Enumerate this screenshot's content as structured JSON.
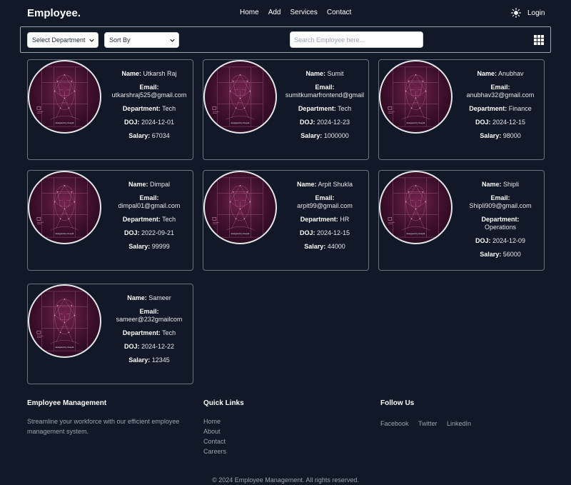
{
  "nav": {
    "brand": "Employee.",
    "links": [
      "Home",
      "Add",
      "Services",
      "Contact"
    ],
    "login": "Login"
  },
  "filters": {
    "department_selected": "Select Department",
    "sort_selected": "Sort By",
    "search_placeholder": "Search Employee here..."
  },
  "labels": {
    "name": "Name:",
    "email": "Email:",
    "department": "Department:",
    "doj": "DOJ:",
    "salary": "Salary:"
  },
  "employees": [
    {
      "name": "Utkarsh Raj",
      "email": "utkarshraj525@gmail.com",
      "department": "Tech",
      "doj": "2024-12-01",
      "salary": "67034"
    },
    {
      "name": "Sumit",
      "email": "sumitkumarfrontend@gmail",
      "department": "Tech",
      "doj": "2024-12-23",
      "salary": "1000000"
    },
    {
      "name": "Anubhav",
      "email": "anubhav32@gmail.com",
      "department": "Finance",
      "doj": "2024-12-15",
      "salary": "98000"
    },
    {
      "name": "Dimpal",
      "email": "dimpal01@gmail.com",
      "department": "Tech",
      "doj": "2022-09-21",
      "salary": "99999"
    },
    {
      "name": "Arpit Shukla",
      "email": "arpit99@gmail.com",
      "department": "HR",
      "doj": "2024-12-15",
      "salary": "44000"
    },
    {
      "name": "Shipli",
      "email": "Shipli909@gmail.com",
      "department": "Operations",
      "doj": "2024-12-09",
      "salary": "56000"
    },
    {
      "name": "Sameer",
      "email": "sameer@232gmailcom",
      "department": "Tech",
      "doj": "2024-12-22",
      "salary": "12345"
    }
  ],
  "avatar_caption": "designed by freepik",
  "footer": {
    "about_title": "Employee Management",
    "about_text": "Streamline your workforce with our efficient employee management system.",
    "links_title": "Quick Links",
    "links": [
      "Home",
      "About",
      "Contact",
      "Careers"
    ],
    "follow_title": "Follow Us",
    "social": [
      "Facebook",
      "Twitter",
      "LinkedIn"
    ],
    "copyright": "© 2024 Employee Management. All rights reserved."
  },
  "colors": {
    "background": "#111827",
    "card_border": "#6b7280",
    "avatar_tint": "#5a1a3e",
    "muted_text": "#9ca3af"
  }
}
